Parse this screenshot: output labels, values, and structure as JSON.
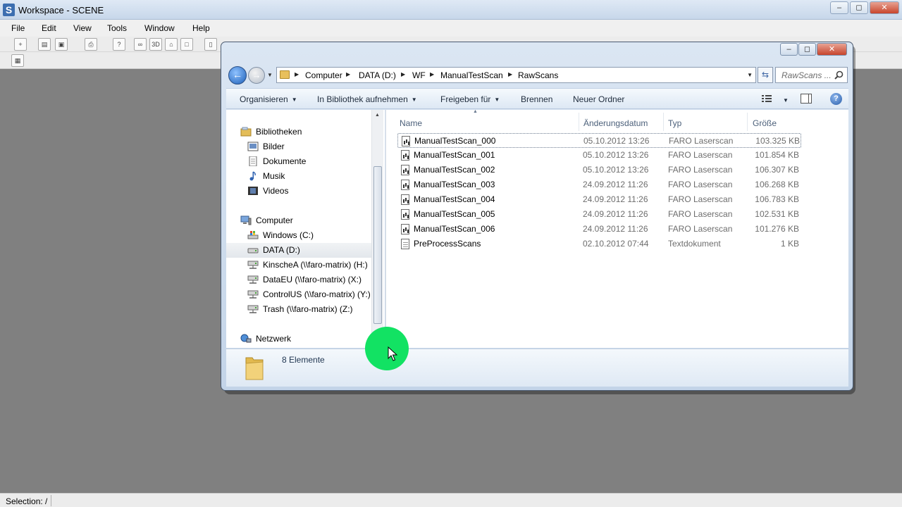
{
  "app": {
    "title": "Workspace - SCENE",
    "logo_letter": "S",
    "controls": [
      "minimize-icon",
      "maximize-icon",
      "close-icon"
    ]
  },
  "menubar": {
    "items": [
      "File",
      "Edit",
      "View",
      "Tools",
      "Window",
      "Help"
    ]
  },
  "toolbar": {
    "threed_label": "3D"
  },
  "statusbar": {
    "text": "Selection: /"
  },
  "dialog": {
    "address": {
      "crumbs": [
        "Computer",
        "DATA (D:)",
        "WF",
        "ManualTestScan",
        "RawScans"
      ]
    },
    "search": {
      "placeholder": "RawScans ..."
    },
    "commands": {
      "organize": "Organisieren",
      "include_library": "In Bibliothek aufnehmen",
      "share": "Freigeben für",
      "burn": "Brennen",
      "new_folder": "Neuer Ordner"
    },
    "nav": {
      "libraries": "Bibliotheken",
      "pictures": "Bilder",
      "documents": "Dokumente",
      "music": "Musik",
      "videos": "Videos",
      "computer": "Computer",
      "drive_c": "Windows (C:)",
      "drive_d": "DATA (D:)",
      "drive_h": "KinscheA (\\\\faro-matrix) (H:)",
      "drive_x": "DataEU (\\\\faro-matrix) (X:)",
      "drive_y": "ControlUS (\\\\faro-matrix) (Y:)",
      "drive_z": "Trash (\\\\faro-matrix) (Z:)",
      "network": "Netzwerk"
    },
    "columns": {
      "name": "Name",
      "date": "Änderungsdatum",
      "type": "Typ",
      "size": "Größe"
    },
    "files": [
      {
        "name": "ManualTestScan_000",
        "date": "05.10.2012 13:26",
        "type": "FARO Laserscan",
        "size": "103.325 KB"
      },
      {
        "name": "ManualTestScan_001",
        "date": "05.10.2012 13:26",
        "type": "FARO Laserscan",
        "size": "101.854 KB"
      },
      {
        "name": "ManualTestScan_002",
        "date": "05.10.2012 13:26",
        "type": "FARO Laserscan",
        "size": "106.307 KB"
      },
      {
        "name": "ManualTestScan_003",
        "date": "24.09.2012 11:26",
        "type": "FARO Laserscan",
        "size": "106.268 KB"
      },
      {
        "name": "ManualTestScan_004",
        "date": "24.09.2012 11:26",
        "type": "FARO Laserscan",
        "size": "106.783 KB"
      },
      {
        "name": "ManualTestScan_005",
        "date": "24.09.2012 11:26",
        "type": "FARO Laserscan",
        "size": "102.531 KB"
      },
      {
        "name": "ManualTestScan_006",
        "date": "24.09.2012 11:26",
        "type": "FARO Laserscan",
        "size": "101.276 KB"
      },
      {
        "name": "PreProcessScans",
        "date": "02.10.2012 07:44",
        "type": "Textdokument",
        "size": "1 KB"
      }
    ],
    "details": {
      "count": "8 Elemente"
    }
  },
  "colors": {
    "cursor_highlight": "#12e263",
    "workspace_bg": "#808080"
  }
}
